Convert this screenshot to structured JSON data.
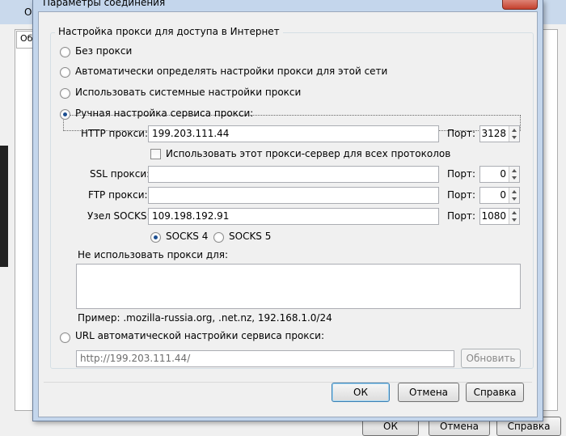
{
  "background": {
    "title_fragment": "О",
    "tab_fragment": "Об",
    "buttons": {
      "ok": "ОК",
      "cancel": "Отмена",
      "help": "Справка"
    }
  },
  "dialog": {
    "title": "Параметры соединения",
    "group_label": "Настройка прокси для доступа в Интернет",
    "options": {
      "no_proxy": "Без прокси",
      "auto_detect": "Автоматически определять настройки прокси для этой сети",
      "system": "Использовать системные настройки прокси",
      "manual": "Ручная настройка сервиса прокси:",
      "auto_url": "URL автоматической настройки сервиса прокси:"
    },
    "selected_option": "manual",
    "http": {
      "label": "HTTP прокси:",
      "value": "199.203.111.44",
      "port_label": "Порт:",
      "port": "3128"
    },
    "use_for_all": {
      "label": "Использовать этот прокси-сервер для всех протоколов",
      "checked": false
    },
    "ssl": {
      "label": "SSL прокси:",
      "value": "",
      "port_label": "Порт:",
      "port": "0"
    },
    "ftp": {
      "label": "FTP прокси:",
      "value": "",
      "port_label": "Порт:",
      "port": "0"
    },
    "socks": {
      "label": "Узел SOCKS:",
      "value": "109.198.192.91",
      "port_label": "Порт:",
      "port": "1080"
    },
    "socks_version": {
      "v4": "SOCKS 4",
      "v5": "SOCKS 5",
      "selected": "v4"
    },
    "no_proxy_for": {
      "label": "Не использовать прокси для:",
      "value": ""
    },
    "example": "Пример: .mozilla-russia.org, .net.nz, 192.168.1.0/24",
    "auto_url_value": "http://199.203.111.44/",
    "reload_button": "Обновить",
    "buttons": {
      "ok": "ОК",
      "cancel": "Отмена",
      "help": "Справка"
    }
  }
}
